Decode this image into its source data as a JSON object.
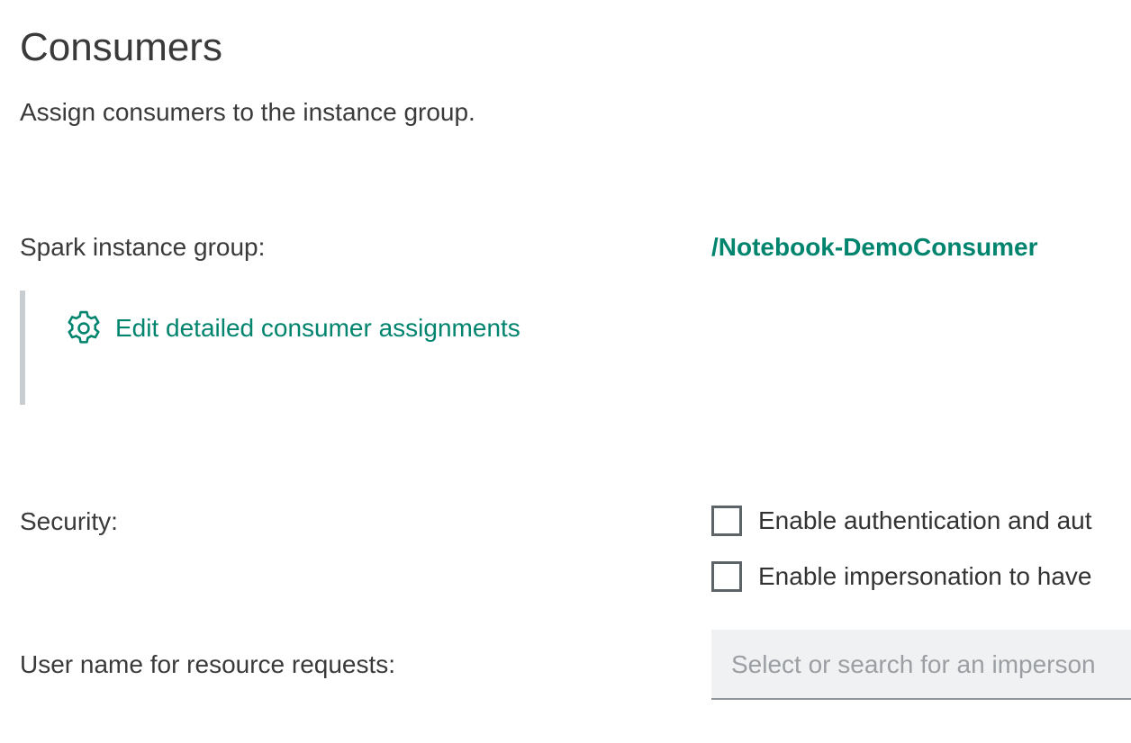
{
  "header": {
    "title": "Consumers",
    "description": "Assign consumers to the instance group."
  },
  "spark_instance_group": {
    "label": "Spark instance group:",
    "value": "/Notebook-DemoConsumer",
    "edit_link_label": "Edit detailed consumer assignments",
    "edit_icon": "gear-icon"
  },
  "security": {
    "label": "Security:",
    "options": [
      {
        "label": "Enable authentication and aut",
        "checked": false
      },
      {
        "label": "Enable impersonation to have",
        "checked": false
      }
    ]
  },
  "user_name": {
    "label": "User name for resource requests:",
    "placeholder": "Select or search for an imperson"
  },
  "colors": {
    "accent": "#00846e",
    "text": "#333333",
    "border_bar": "#c8cdd1",
    "input_bg": "#f0f1f2"
  }
}
